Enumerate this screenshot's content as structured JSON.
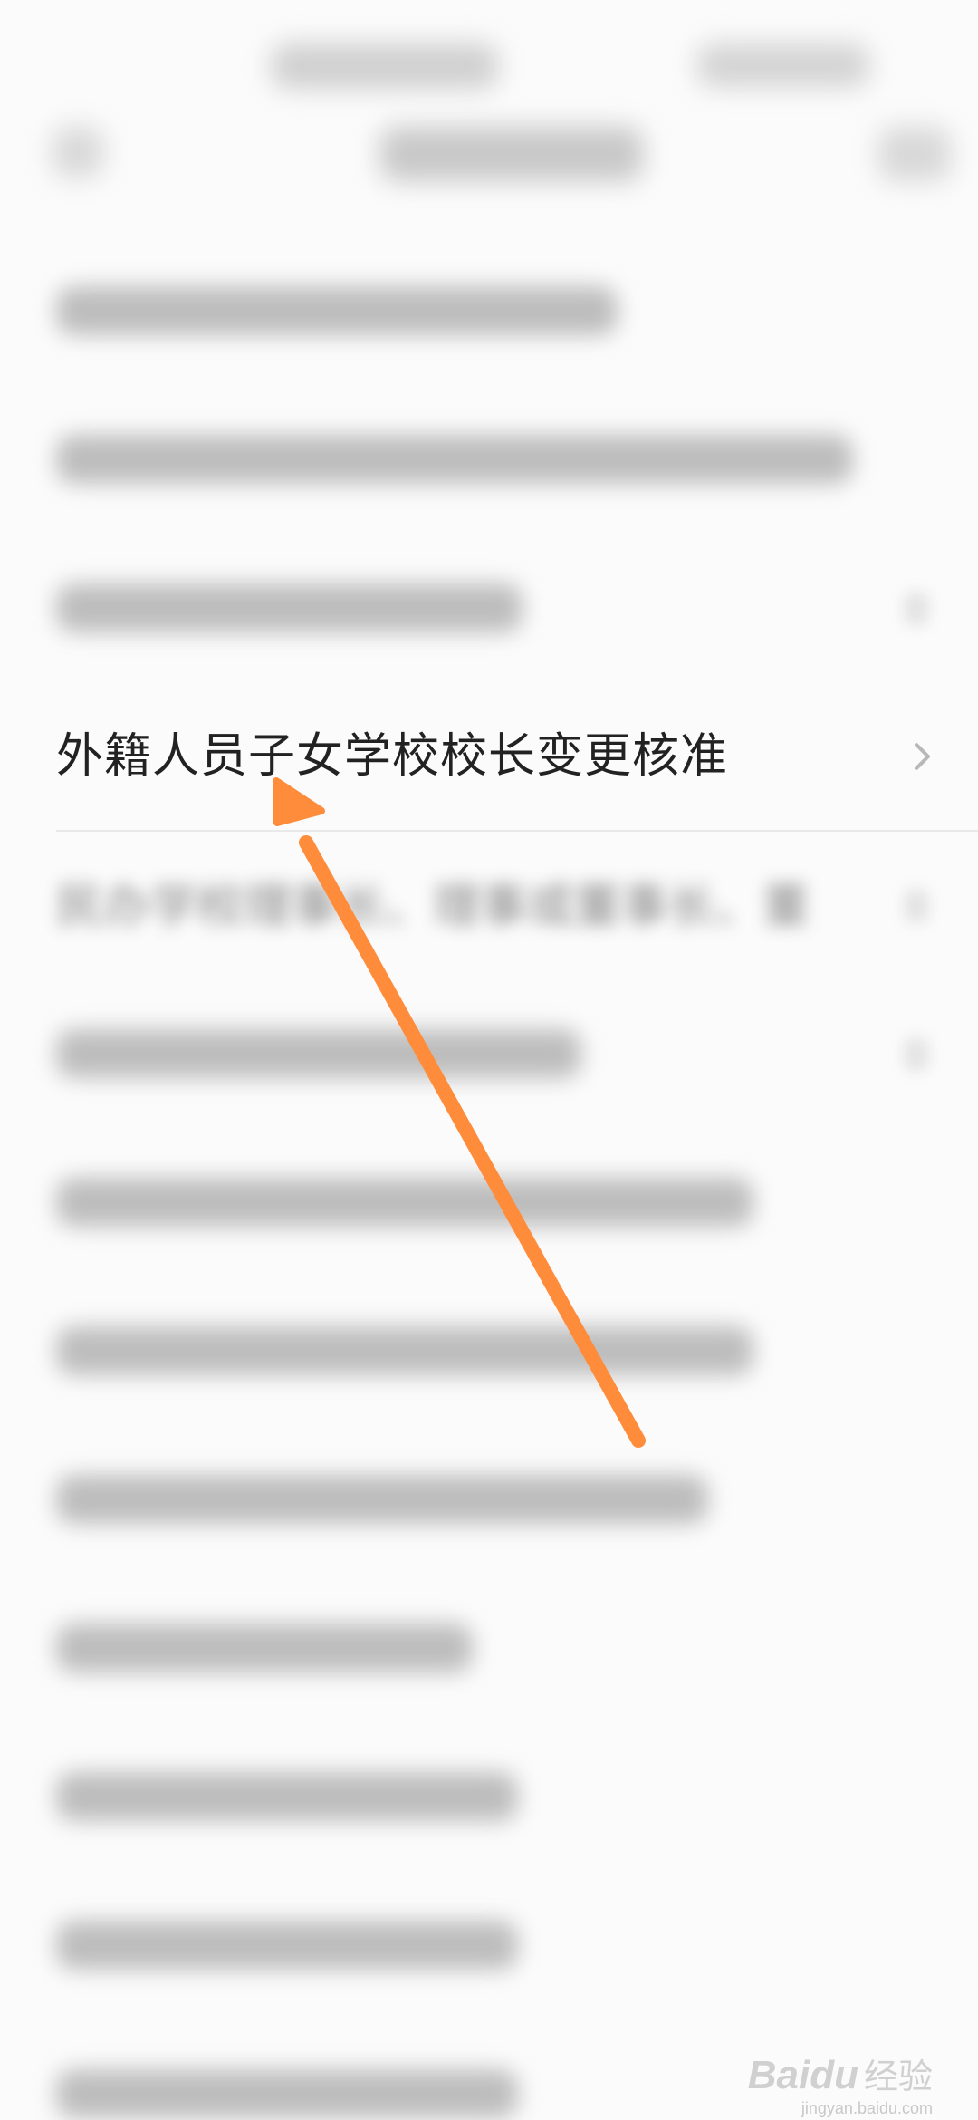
{
  "list": {
    "focused_item": {
      "label": "外籍人员子女学校校长变更核准"
    },
    "partially_visible_item": {
      "label": "民办学校理事长、理事或董事长、董"
    }
  },
  "annotation": {
    "arrow_color": "#ff8c3a"
  },
  "watermark": {
    "brand": "Baidu",
    "brand_cn": "经验",
    "domain": "jingyan.baidu.com"
  }
}
